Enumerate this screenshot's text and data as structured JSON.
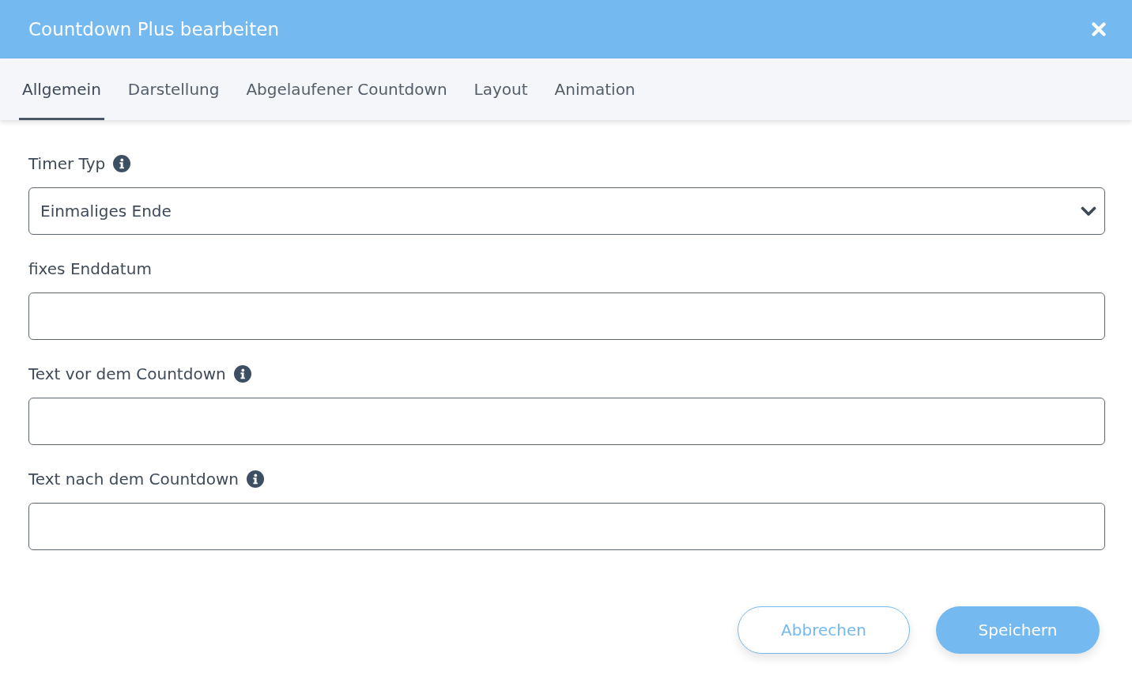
{
  "window": {
    "title": "Countdown Plus bearbeiten"
  },
  "tabs": [
    {
      "label": "Allgemein",
      "selected": true
    },
    {
      "label": "Darstellung",
      "selected": false
    },
    {
      "label": "Abgelaufener Countdown",
      "selected": false
    },
    {
      "label": "Layout",
      "selected": false
    },
    {
      "label": "Animation",
      "selected": false
    }
  ],
  "fields": [
    {
      "kind": "select",
      "label": "Timer Typ",
      "info": true,
      "value": "Einmaliges Ende"
    },
    {
      "kind": "text",
      "label": "fixes Enddatum",
      "info": false
    },
    {
      "kind": "text",
      "label": "Text vor dem Countdown",
      "info": true
    },
    {
      "kind": "text",
      "label": "Text nach dem Countdown",
      "info": true
    }
  ],
  "buttons": [
    {
      "label": "Abbrechen",
      "kind": "secondary"
    },
    {
      "label": "Speichern",
      "kind": "primary"
    }
  ]
}
